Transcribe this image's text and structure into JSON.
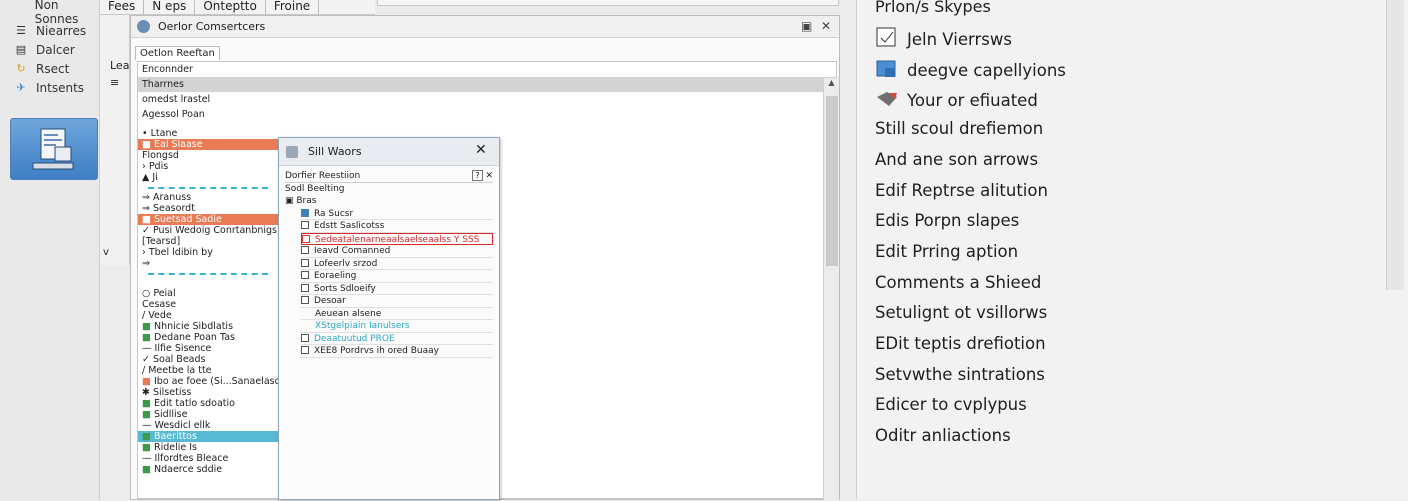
{
  "nav": {
    "items": [
      {
        "label": "Non Sonnes",
        "icon": "blank-icon"
      },
      {
        "label": "Niearres",
        "icon": "document-stack-icon"
      },
      {
        "label": "Dalcer",
        "icon": "panel-icon"
      },
      {
        "label": "Rsect",
        "icon": "refresh-icon"
      },
      {
        "label": "Intsents",
        "icon": "plane-icon"
      }
    ]
  },
  "top_tabs": [
    "Fees",
    "N eps",
    "Onteptto",
    "Froine"
  ],
  "side_col": {
    "label": "Lea",
    "chevron": "v"
  },
  "main_window": {
    "title": "Oerlor Comsertcers",
    "tab": "Oetlon Reeftan",
    "header_rows": [
      "Enconnder",
      "Tharrnes",
      "omedst lrastel",
      "Agessol Poan"
    ],
    "list_rows": [
      {
        "text": "Ltane",
        "style": "plain",
        "icon": "dot"
      },
      {
        "text": "Eal Slaase",
        "style": "hl",
        "icon": "square"
      },
      {
        "text": "Flongsd",
        "style": "plain",
        "icon": ""
      },
      {
        "text": "Pdis",
        "style": "plain",
        "icon": "chev"
      },
      {
        "text": "Ji",
        "style": "cyan-line",
        "icon": "triangle"
      },
      {
        "text": "Aranuss",
        "style": "plain",
        "icon": "arrow"
      },
      {
        "text": "Seasordt",
        "style": "plain",
        "icon": "arrow"
      },
      {
        "text": "Suetsad Sadie",
        "style": "hl",
        "icon": "square"
      },
      {
        "text": "Pusi Wedoig Conrtanbnigs)",
        "style": "plain",
        "icon": "tick"
      },
      {
        "text": "[Tearsd]",
        "style": "plain",
        "icon": ""
      },
      {
        "text": "Tbel ldibin by",
        "style": "plain",
        "icon": "chev"
      },
      {
        "text": "",
        "style": "cyan-line",
        "icon": "arrow"
      },
      {
        "text": "",
        "style": "spacer",
        "icon": ""
      },
      {
        "text": "Peial",
        "style": "plain",
        "icon": "circle"
      },
      {
        "text": "Cesase",
        "style": "plain",
        "icon": ""
      },
      {
        "text": "Vede",
        "style": "plain",
        "icon": "slash"
      },
      {
        "text": "Nhnicie Sibdlatis",
        "style": "plain",
        "icon": "green"
      },
      {
        "text": "Dedane Poan Tas",
        "style": "plain",
        "icon": "green"
      },
      {
        "text": "Ilfie Sisence",
        "style": "plain",
        "icon": "dash"
      },
      {
        "text": "Soal Beads",
        "style": "plain",
        "icon": "tick"
      },
      {
        "text": "Meetbe la tte",
        "style": "plain",
        "icon": "slash"
      },
      {
        "text": "Ibo ae foee (Si...Sanaelasd Oes",
        "style": "plain",
        "icon": "orange"
      },
      {
        "text": "Silsetiss",
        "style": "plain",
        "icon": "star"
      },
      {
        "text": "Edit tatlo sdoatio",
        "style": "plain",
        "icon": "green"
      },
      {
        "text": "Sidllise",
        "style": "plain",
        "icon": "green"
      },
      {
        "text": "Wesdicl ellk",
        "style": "plain",
        "icon": "dash"
      },
      {
        "text": "Baerittos",
        "style": "hl2",
        "icon": "green"
      },
      {
        "text": "Ridelie Is",
        "style": "plain",
        "icon": "green"
      },
      {
        "text": "Ilfordtes Bleace",
        "style": "plain",
        "icon": "dash"
      },
      {
        "text": "Ndaerce sddie",
        "style": "plain",
        "icon": "green"
      }
    ]
  },
  "dialog": {
    "title": "Sill Waors",
    "section": "Dorfier Reestiion",
    "sub": "Sodl Beelting",
    "group": "Bras",
    "rows": [
      {
        "text": "Ra Sucsr",
        "check": "blue"
      },
      {
        "text": "Edstt Saslicotss",
        "check": "box"
      },
      {
        "text": "Sedeatalenarneaalsaelseaalss Y SSS",
        "check": "red"
      },
      {
        "text": "Ieavd Comanned",
        "check": "box"
      },
      {
        "text": "Lofeerlv srzod",
        "check": "box"
      },
      {
        "text": "Eoraeling",
        "check": "box"
      },
      {
        "text": "Sorts Sdloeify",
        "check": "box"
      },
      {
        "text": "Desoar",
        "check": "box"
      },
      {
        "text": "Aeuean alsene",
        "check": "none"
      },
      {
        "text": "XStgelpiain Ianulsers",
        "check": "none"
      },
      {
        "text": "Deaatuutud PROE",
        "check": "box"
      },
      {
        "text": "XEE8 Pordrvs ih ored Buaay",
        "check": "box"
      }
    ]
  },
  "right_panel": {
    "title": "Prlon/s Skypes",
    "items": [
      {
        "label": "Jeln Vierrsws",
        "icon": "checkbox-icon"
      },
      {
        "label": "deegve capellyions",
        "icon": "image-folder-icon"
      },
      {
        "label": "Your or efiuated",
        "icon": "tag-shield-icon"
      },
      {
        "label": "Still scoul drefiemon",
        "icon": ""
      },
      {
        "label": "And ane son arrows",
        "icon": ""
      },
      {
        "label": "Edif Reptrse alitution",
        "icon": ""
      },
      {
        "label": "Edis Porpn slapes",
        "icon": ""
      },
      {
        "label": "Edit Prring aption",
        "icon": ""
      },
      {
        "label": "Comments a Shieed",
        "icon": ""
      },
      {
        "label": "Setulignt ot vsillorws",
        "icon": ""
      },
      {
        "label": "EDit teptis drefiotion",
        "icon": ""
      },
      {
        "label": "Setvwthe sintrations",
        "icon": ""
      },
      {
        "label": "Edicer to cvplypus",
        "icon": ""
      },
      {
        "label": "Oditr anliactions",
        "icon": ""
      }
    ]
  },
  "colors": {
    "accent_orange": "#e97b55",
    "accent_cyan": "#37b5cf",
    "accent_green": "#3c9a4b",
    "tile_blue": "#3e7ec4"
  }
}
